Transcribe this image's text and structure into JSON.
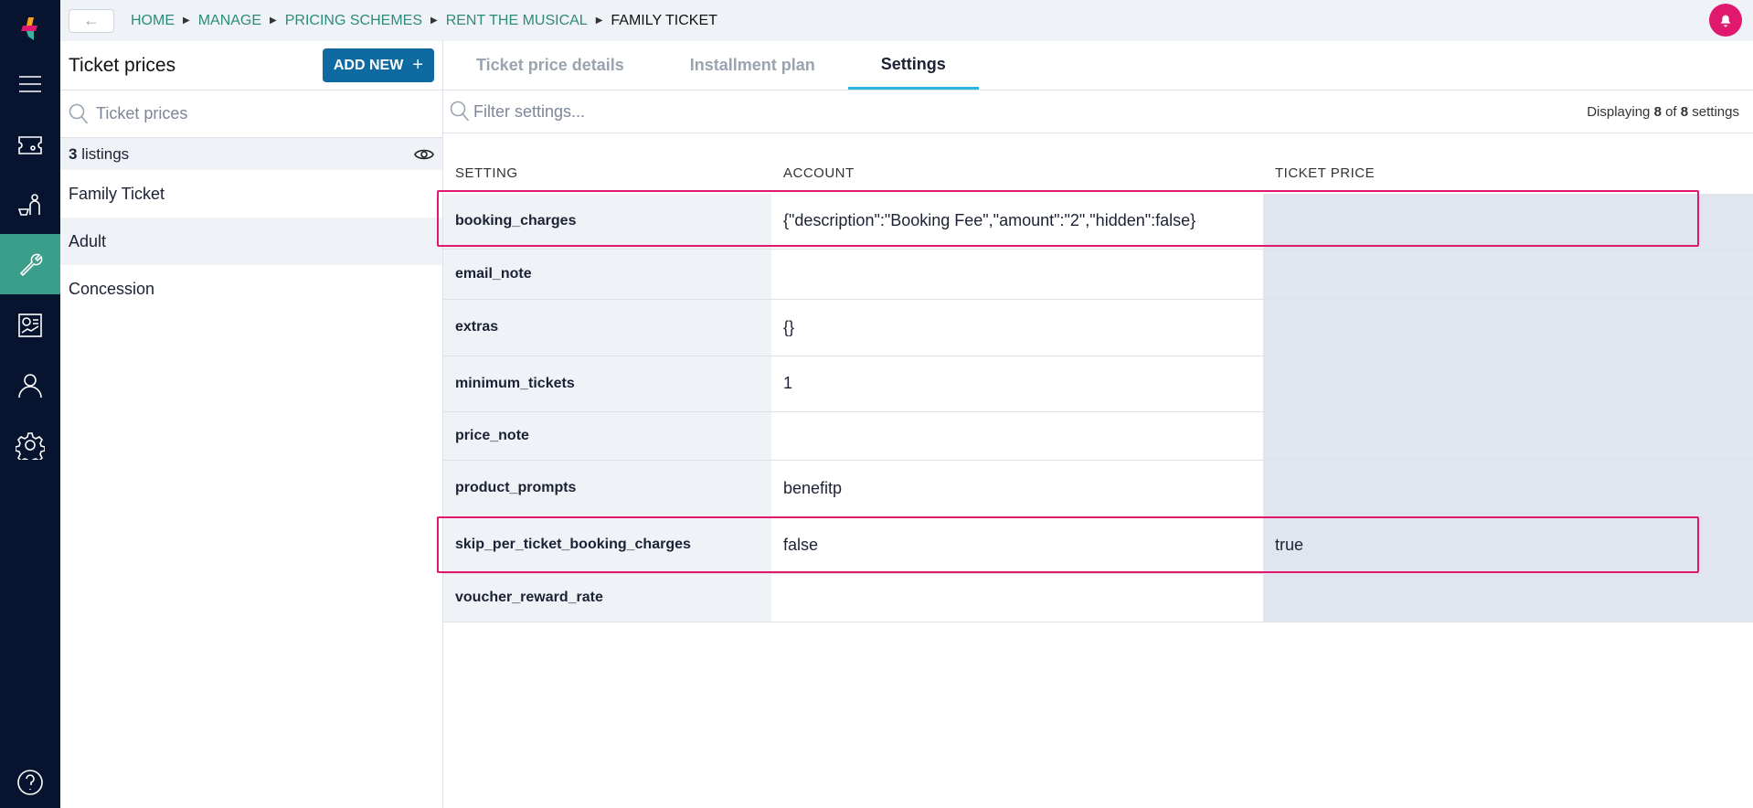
{
  "sidebar": {
    "items": [
      "menu-icon",
      "ticket-icon",
      "customer-basket-icon",
      "wrench-icon",
      "report-icon",
      "user-icon",
      "gear-icon",
      "help-icon"
    ],
    "active": "wrench-icon"
  },
  "breadcrumb": {
    "items": [
      "HOME",
      "MANAGE",
      "PRICING SCHEMES",
      "RENT THE MUSICAL"
    ],
    "current": "FAMILY TICKET"
  },
  "left": {
    "title": "Ticket prices",
    "add_label": "ADD NEW",
    "add_icon": "+",
    "search_placeholder": "Ticket prices",
    "listings_count": "3",
    "listings_label": "listings",
    "items": [
      "Family Ticket",
      "Adult",
      "Concession"
    ]
  },
  "tabs": [
    "Ticket price details",
    "Installment plan",
    "Settings"
  ],
  "filter": {
    "placeholder": "Filter settings...",
    "display_prefix": "Displaying",
    "shown": "8",
    "of": "of",
    "total": "8",
    "suffix": "settings"
  },
  "table": {
    "headers": [
      "SETTING",
      "ACCOUNT",
      "TICKET PRICE"
    ],
    "rows": [
      {
        "setting": "booking_charges",
        "account": "{\"description\":\"Booking Fee\",\"amount\":\"2\",\"hidden\":false}",
        "ticket_price": ""
      },
      {
        "setting": "email_note",
        "account": "",
        "ticket_price": ""
      },
      {
        "setting": "extras",
        "account": "{}",
        "ticket_price": ""
      },
      {
        "setting": "minimum_tickets",
        "account": "1",
        "ticket_price": ""
      },
      {
        "setting": "price_note",
        "account": "",
        "ticket_price": ""
      },
      {
        "setting": "product_prompts",
        "account": "benefitp",
        "ticket_price": ""
      },
      {
        "setting": "skip_per_ticket_booking_charges",
        "account": "false",
        "ticket_price": "true"
      },
      {
        "setting": "voucher_reward_rate",
        "account": "",
        "ticket_price": ""
      }
    ]
  },
  "colors": {
    "highlight": "#e0196e",
    "accent": "#0e6aa0",
    "active_nav": "#3a9e8a"
  }
}
